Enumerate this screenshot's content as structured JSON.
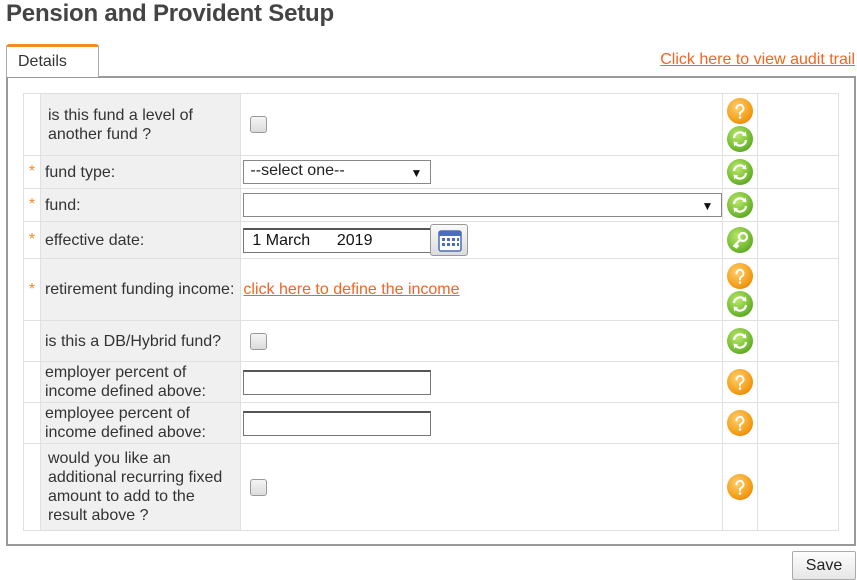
{
  "page": {
    "title": "Pension and Provident Setup"
  },
  "tabs": [
    {
      "label": "Details"
    }
  ],
  "audit_link": "Click here to view audit trail",
  "form": {
    "level_of_fund": {
      "label": "is this fund a level of another fund ?",
      "checked": false
    },
    "fund_type": {
      "label": "fund type:",
      "value": "--select one--",
      "required": "*"
    },
    "fund": {
      "label": "fund:",
      "value": "",
      "required": "*"
    },
    "effective_date": {
      "label": "effective date:",
      "value": "1 March      2019",
      "required": "*"
    },
    "retirement_income": {
      "label": "retirement funding income:",
      "link": "click here to define the income",
      "required": "*"
    },
    "db_hybrid": {
      "label": "is this a DB/Hybrid fund?",
      "checked": false
    },
    "employer_percent": {
      "label": "employer percent of income defined above:",
      "value": ""
    },
    "employee_percent": {
      "label": "employee percent of income defined above:",
      "value": ""
    },
    "additional_fixed": {
      "label": "would you like an additional recurring fixed amount to add to the result above ?",
      "checked": false
    }
  },
  "buttons": {
    "save": "Save"
  },
  "icons": {
    "help": "help-icon",
    "refresh": "refresh-icon",
    "key": "key-icon",
    "calendar": "calendar-icon"
  },
  "colors": {
    "accent": "#f26522",
    "required": "#f28c28",
    "help": "#f39a13",
    "refresh": "#6cb52d"
  }
}
